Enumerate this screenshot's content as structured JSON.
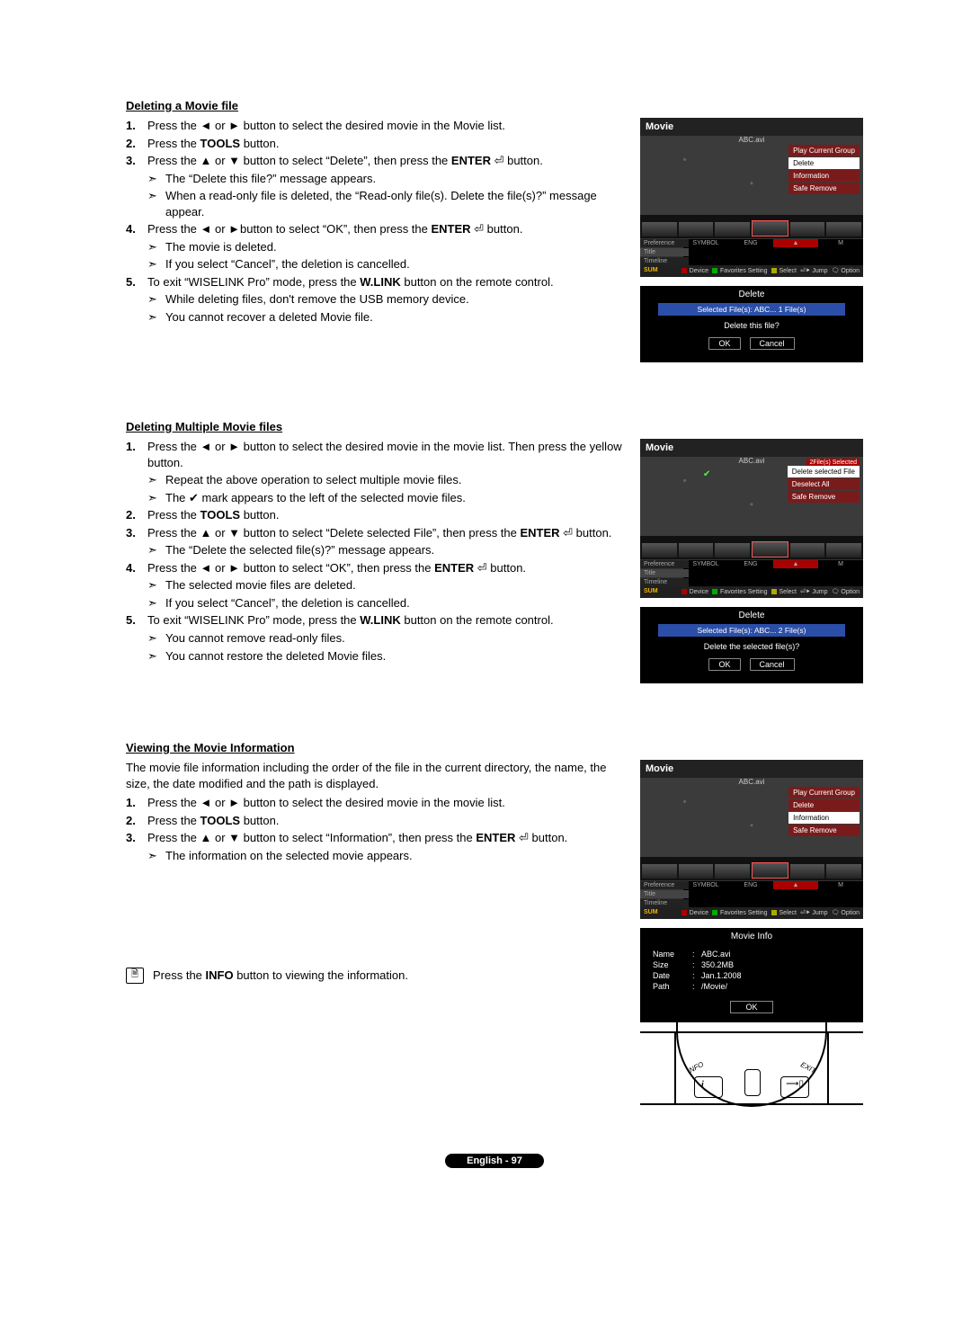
{
  "page_number": "English - 97",
  "sectionA": {
    "title": "Deleting a Movie file",
    "steps": [
      {
        "n": "1.",
        "t": "Press the ◄ or ► button to select the desired movie in the Movie list."
      },
      {
        "n": "2.",
        "t": "Press the <b>TOOLS</b> button."
      },
      {
        "n": "3.",
        "t": "Press the ▲ or ▼ button to select “Delete”, then press the  <b>ENTER</b> ⏎ button.",
        "subs": [
          "The “Delete this file?” message appears.",
          "When a read-only file is deleted, the “Read-only file(s). Delete the file(s)?” message appear."
        ]
      },
      {
        "n": "4.",
        "t": "Press the ◄ or ►button to select “OK”, then press the  <b>ENTER</b> ⏎ button.",
        "subs": [
          "The movie is deleted.",
          "If you select “Cancel”, the deletion is cancelled."
        ]
      },
      {
        "n": "5.",
        "t": "To exit “WISELINK Pro” mode, press the <b>W.LINK</b> button on the remote control.",
        "subs": [
          "While deleting files, don't remove the USB memory device.",
          "You cannot recover a deleted Movie file."
        ]
      }
    ],
    "tv": {
      "title": "Movie",
      "file": "ABC.avi",
      "menu": [
        "Play Current Group",
        "Delete",
        "Information",
        "Safe Remove"
      ],
      "hi": 1,
      "sort_label1": "Preference",
      "sort_label2": "Title",
      "sort_label3": "Timeline",
      "sort_v1": "SYMBOL",
      "sort_v2": "ENG",
      "sort_v3": "",
      "sort_v4": "M",
      "sum": "SUM",
      "f_device": "Device",
      "f_fav": "Favorites Setting",
      "f_sel": "Select",
      "f_jump": "Jump",
      "f_opt": "Option"
    },
    "dlg": {
      "title": "Delete",
      "sel": "Selected File(s): ABC...   1 File(s)",
      "q": "Delete this file?",
      "ok": "OK",
      "cancel": "Cancel"
    }
  },
  "sectionB": {
    "title": "Deleting Multiple Movie files",
    "steps": [
      {
        "n": "1.",
        "t": "Press the ◄ or ► button to select the desired movie in the movie list. Then press the yellow button.",
        "subs": [
          "Repeat the above operation to select multiple movie files.",
          "The ✔ mark appears to the left of the selected movie files."
        ]
      },
      {
        "n": "2.",
        "t": "Press the <b>TOOLS</b> button."
      },
      {
        "n": "3.",
        "t": "Press the ▲ or ▼ button to select “Delete selected File”, then press the <b>ENTER</b> ⏎ button.",
        "subs": [
          "The “Delete the selected file(s)?” message appears."
        ]
      },
      {
        "n": "4.",
        "t": "Press the ◄ or ► button to select “OK”, then press the <b>ENTER</b> ⏎ button.",
        "subs": [
          "The selected movie files are deleted.",
          "If you select “Cancel”, the deletion is cancelled."
        ]
      },
      {
        "n": "5.",
        "t": "To exit “WISELINK Pro” mode, press the <b>W.LINK</b> button on the remote control.",
        "subs": [
          "You cannot remove read-only files.",
          "You cannot restore the deleted Movie files."
        ]
      }
    ],
    "tv": {
      "title": "Movie",
      "file": "ABC.avi",
      "status": "2File(s) Selected",
      "menu": [
        "Delete selected File",
        "Deselect All",
        "Safe Remove"
      ],
      "hi": 0,
      "sort_label1": "Preference",
      "sort_label2": "Title",
      "sort_label3": "Timeline",
      "sort_v1": "SYMBOL",
      "sort_v2": "ENG",
      "sort_v3": "",
      "sort_v4": "M",
      "sum": "SUM",
      "f_device": "Device",
      "f_fav": "Favorites Setting",
      "f_sel": "Select",
      "f_jump": "Jump",
      "f_opt": "Option"
    },
    "dlg": {
      "title": "Delete",
      "sel": "Selected File(s): ABC...   2 File(s)",
      "q": "Delete the selected file(s)?",
      "ok": "OK",
      "cancel": "Cancel"
    }
  },
  "sectionC": {
    "title": "Viewing the Movie Information",
    "intro": "The movie file information including the order of the file in the current directory, the name, the size, the date modified and the path is displayed.",
    "steps": [
      {
        "n": "1.",
        "t": "Press the ◄ or ► button to select the desired movie in the movie list."
      },
      {
        "n": "2.",
        "t": "Press the <b>TOOLS</b> button."
      },
      {
        "n": "3.",
        "t": "Press the ▲ or ▼ button to select “Information”, then press the <b>ENTER</b> ⏎  button.",
        "subs": [
          "The information on the selected movie appears."
        ]
      }
    ],
    "note": "Press the <b>INFO</b> button to viewing the information.",
    "tv": {
      "title": "Movie",
      "file": "ABC.avi",
      "menu": [
        "Play Current Group",
        "Delete",
        "Information",
        "Safe Remove"
      ],
      "hi": 2,
      "sort_label1": "Preference",
      "sort_label2": "Title",
      "sort_label3": "Timeline",
      "sort_v1": "SYMBOL",
      "sort_v2": "ENG",
      "sort_v3": "",
      "sort_v4": "M",
      "sum": "SUM",
      "f_device": "Device",
      "f_fav": "Favorites Setting",
      "f_sel": "Select",
      "f_jump": "Jump",
      "f_opt": "Option"
    },
    "info": {
      "title": "Movie Info",
      "rows": [
        {
          "k": "Name",
          "v": "ABC.avi"
        },
        {
          "k": "Size",
          "v": "350.2MB"
        },
        {
          "k": "Date",
          "v": "Jan.1.2008"
        },
        {
          "k": "Path",
          "v": "/Movie/"
        }
      ],
      "ok": "OK"
    },
    "remote": {
      "info": "INFO",
      "exit": "EXIT"
    }
  }
}
